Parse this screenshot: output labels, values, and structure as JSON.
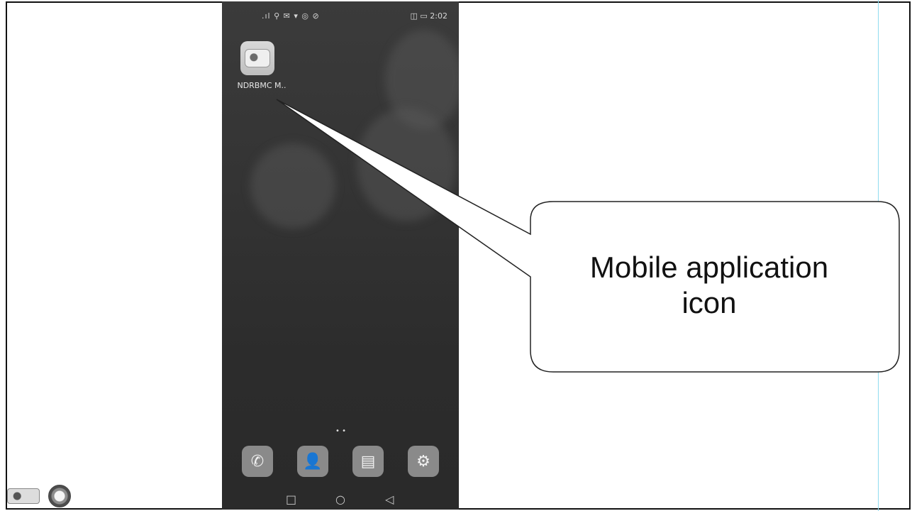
{
  "phone": {
    "status_bar": {
      "left_icons": ".ıl ⚲ ✉ ▾ ◎ ⊘",
      "right_icons": "◫ ▭ 2:02"
    },
    "app": {
      "label": "NDRBMC M..",
      "icon": "ndrbmc-app-icon"
    },
    "page_indicator": "• •",
    "dock": [
      {
        "name": "phone-icon",
        "glyph": "✆"
      },
      {
        "name": "contacts-icon",
        "glyph": "👤"
      },
      {
        "name": "messages-icon",
        "glyph": "▤"
      },
      {
        "name": "settings-icon",
        "glyph": "⚙"
      }
    ],
    "nav": {
      "recent": "□",
      "home": "○",
      "back": "◁"
    }
  },
  "callout": {
    "line1": "Mobile application",
    "line2": "icon"
  },
  "colors": {
    "phone_bg": "#333333",
    "frame": "#111111",
    "guide": "#8fdcef"
  }
}
